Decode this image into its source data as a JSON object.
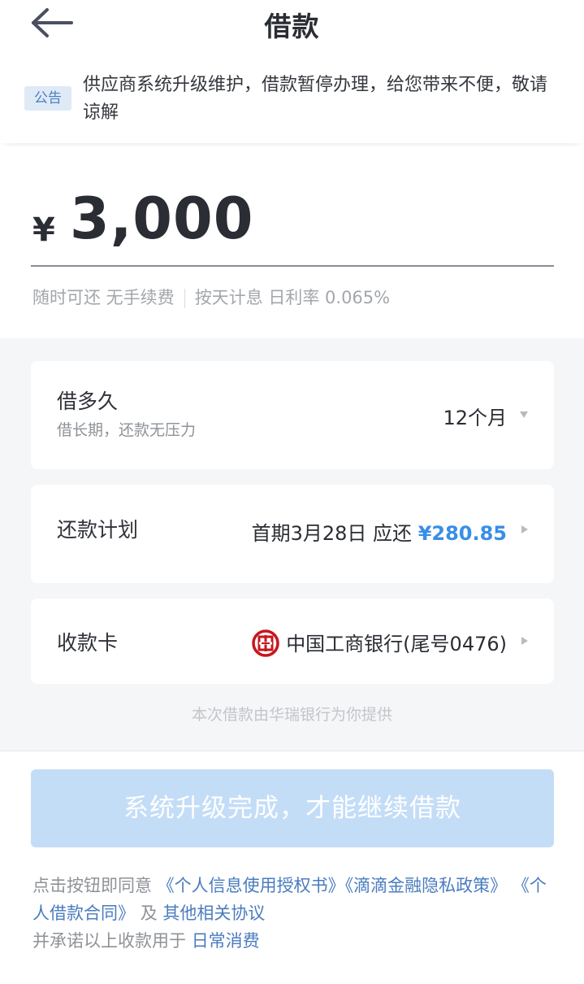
{
  "header": {
    "title": "借款",
    "back_icon": "arrow-left-icon"
  },
  "notice": {
    "tag": "公告",
    "text": "供应商系统升级维护，借款暂停办理，给您带来不便，敬请谅解"
  },
  "amount": {
    "currency": "¥",
    "value": "3,000",
    "tip_left": "随时可还 无手续费",
    "tip_right": "按天计息 日利率 0.065%"
  },
  "term": {
    "label": "借多久",
    "sub": "借长期，还款无压力",
    "value": "12个月",
    "icon": "caret-down-icon"
  },
  "plan": {
    "label": "还款计划",
    "value_prefix": "首期3月28日 应还",
    "amount": "¥280.85",
    "icon": "caret-right-icon"
  },
  "card": {
    "label": "收款卡",
    "bank_icon": "icbc-logo-icon",
    "value": "中国工商银行(尾号0476)",
    "icon": "caret-right-icon"
  },
  "provider_text": "本次借款由华瑞银行为你提供",
  "submit_label": "系统升级完成，才能继续借款",
  "agreement": {
    "prefix": "点击按钮即同意",
    "link1": "《个人信息使用授权书》",
    "link2": "《滴滴金融隐私政策》",
    "link3": "《个人借款合同》",
    "conj": "及",
    "link4": "其他相关协议",
    "line2_prefix": "并承诺以上收款用于",
    "link5": "日常消费"
  },
  "colors": {
    "accent": "#3a8ee6",
    "button_disabled": "#c4ddf7",
    "notice_tag_bg": "#dfeaf7",
    "bank_red": "#c7161e"
  }
}
